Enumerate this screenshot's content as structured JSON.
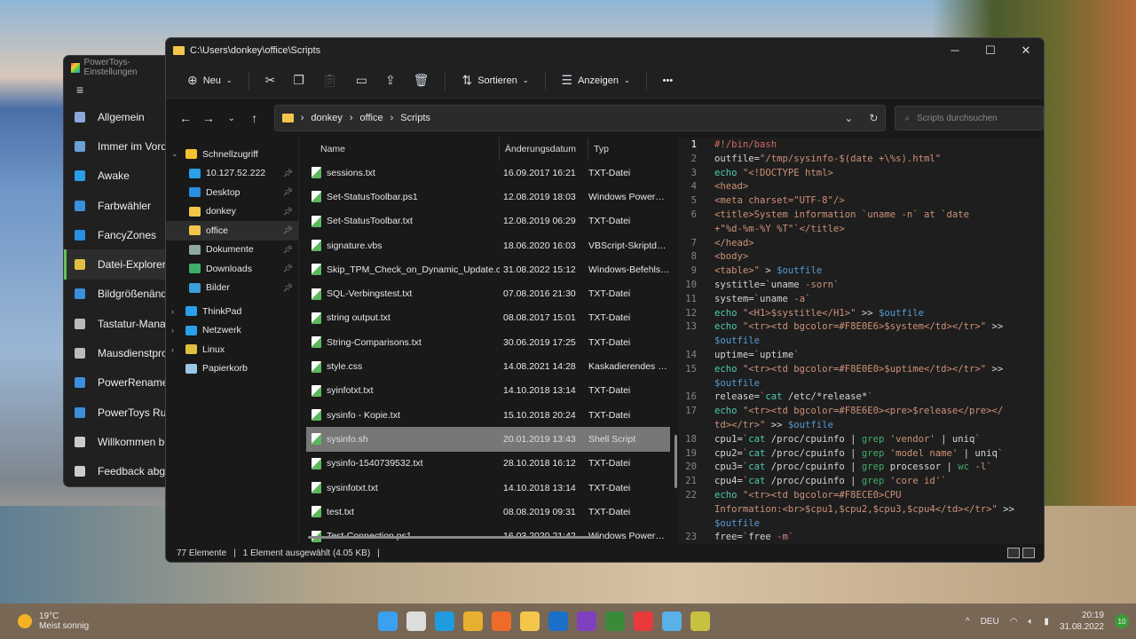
{
  "powertoys": {
    "title": "PowerToys-Einstellungen",
    "menu_icon": "hamburger-icon",
    "items": [
      {
        "label": "Allgemein",
        "color": "#8aa8d8"
      },
      {
        "label": "Immer im Vordergrund",
        "color": "#6ea0d8"
      },
      {
        "label": "Awake",
        "color": "#2a9ee8"
      },
      {
        "label": "Farbwähler",
        "color": "#3b8fdc"
      },
      {
        "label": "FancyZones",
        "color": "#2a8fe0"
      },
      {
        "label": "Datei-Explorer",
        "color": "#e0c040"
      },
      {
        "label": "Bildgrößenänderung",
        "color": "#3b8fdc"
      },
      {
        "label": "Tastatur-Manager",
        "color": "#bbbbbb"
      },
      {
        "label": "Mausdienstprogramme",
        "color": "#bbbbbb"
      },
      {
        "label": "PowerRename",
        "color": "#3b8fdc"
      },
      {
        "label": "PowerToys Run",
        "color": "#3b8fdc"
      },
      {
        "label": "Willkommen bei PowerToys",
        "color": "#cccccc"
      },
      {
        "label": "Feedback abgeben",
        "color": "#cccccc"
      }
    ],
    "selected": "Datei-Explorer"
  },
  "explorer": {
    "title": "C:\\Users\\donkey\\office\\Scripts",
    "toolbar": {
      "new": "Neu",
      "sort": "Sortieren",
      "view": "Anzeigen",
      "more": "•••"
    },
    "breadcrumb": [
      "donkey",
      "office",
      "Scripts"
    ],
    "search_placeholder": "Scripts durchsuchen",
    "nav": [
      {
        "label": "Schnellzugriff",
        "level": 0,
        "chev": "⌄",
        "color": "#f5c230"
      },
      {
        "label": "10.127.52.222",
        "level": 1,
        "pin": true,
        "color": "#2aa0e8"
      },
      {
        "label": "Desktop",
        "level": 1,
        "pin": true,
        "color": "#2a8fe0"
      },
      {
        "label": "donkey",
        "level": 1,
        "pin": true,
        "color": "#f3c64a"
      },
      {
        "label": "office",
        "level": 1,
        "pin": true,
        "color": "#f3c64a",
        "selected": true
      },
      {
        "label": "Dokumente",
        "level": 1,
        "pin": true,
        "color": "#8fa8a0"
      },
      {
        "label": "Downloads",
        "level": 1,
        "pin": true,
        "color": "#3fae6a"
      },
      {
        "label": "Bilder",
        "level": 1,
        "pin": true,
        "color": "#3b9fdc"
      },
      {
        "label": "ThinkPad",
        "level": 0,
        "chev": "›",
        "color": "#2aa0e8"
      },
      {
        "label": "Netzwerk",
        "level": 0,
        "chev": "›",
        "color": "#2aa0e8"
      },
      {
        "label": "Linux",
        "level": 0,
        "chev": "›",
        "color": "#e0c040"
      },
      {
        "label": "Papierkorb",
        "level": 0,
        "color": "#9cc8e8"
      }
    ],
    "columns": {
      "name": "Name",
      "date": "Änderungsdatum",
      "type": "Typ"
    },
    "files": [
      {
        "name": "sessions.txt",
        "date": "16.09.2017 16:21",
        "type": "TXT-Datei"
      },
      {
        "name": "Set-StatusToolbar.ps1",
        "date": "12.08.2019 18:03",
        "type": "Windows PowerSh..."
      },
      {
        "name": "Set-StatusToolbar.txt",
        "date": "12.08.2019 06:29",
        "type": "TXT-Datei"
      },
      {
        "name": "signature.vbs",
        "date": "18.06.2020 16:03",
        "type": "VBScript-Skriptdat..."
      },
      {
        "name": "Skip_TPM_Check_on_Dynamic_Update.cmd",
        "date": "31.08.2022 15:12",
        "type": "Windows-Befehlss..."
      },
      {
        "name": "SQL-Verbingstest.txt",
        "date": "07.08.2016 21:30",
        "type": "TXT-Datei"
      },
      {
        "name": "string output.txt",
        "date": "08.08.2017 15:01",
        "type": "TXT-Datei"
      },
      {
        "name": "String-Comparisons.txt",
        "date": "30.06.2019 17:25",
        "type": "TXT-Datei"
      },
      {
        "name": "style.css",
        "date": "14.08.2021 14:28",
        "type": "Kaskadierendes St..."
      },
      {
        "name": "syinfotxt.txt",
        "date": "14.10.2018 13:14",
        "type": "TXT-Datei"
      },
      {
        "name": "sysinfo - Kopie.txt",
        "date": "15.10.2018 20:24",
        "type": "TXT-Datei"
      },
      {
        "name": "sysinfo.sh",
        "date": "20.01.2019 13:43",
        "type": "Shell Script",
        "selected": true
      },
      {
        "name": "sysinfo-1540739532.txt",
        "date": "28.10.2018 16:12",
        "type": "TXT-Datei"
      },
      {
        "name": "sysinfotxt.txt",
        "date": "14.10.2018 13:14",
        "type": "TXT-Datei"
      },
      {
        "name": "test.txt",
        "date": "08.08.2019 09:31",
        "type": "TXT-Datei"
      },
      {
        "name": "Test-Connection.ps1",
        "date": "16.03.2020 21:42",
        "type": "Windows PowerSh..."
      }
    ],
    "code": [
      {
        "n": "1",
        "segs": [
          [
            "#!/bin/bash",
            "c"
          ]
        ]
      },
      {
        "n": "2",
        "segs": [
          [
            "outfile=",
            "p"
          ],
          [
            "\"/tmp/sysinfo-$(date +\\%s).html\"",
            "s"
          ]
        ]
      },
      {
        "n": "3",
        "segs": [
          [
            "echo ",
            "k"
          ],
          [
            "\"<!DOCTYPE html>",
            "s"
          ]
        ]
      },
      {
        "n": "4",
        "segs": [
          [
            "<head>",
            "s"
          ]
        ]
      },
      {
        "n": "5",
        "segs": [
          [
            "<meta charset=\"UTF-8\"/>",
            "s"
          ]
        ]
      },
      {
        "n": "6",
        "segs": [
          [
            "<title>System information `uname -n` at `date",
            "s"
          ]
        ]
      },
      {
        "n": "",
        "segs": [
          [
            "+\"%d-%m-%Y %T\"`</title>",
            "s"
          ]
        ]
      },
      {
        "n": "7",
        "segs": [
          [
            "</head>",
            "s"
          ]
        ]
      },
      {
        "n": "8",
        "segs": [
          [
            "<body>",
            "s"
          ]
        ]
      },
      {
        "n": "9",
        "segs": [
          [
            "<table>\" ",
            "s"
          ],
          [
            "> ",
            "p"
          ],
          [
            "$outfile",
            "v"
          ]
        ]
      },
      {
        "n": "10",
        "segs": [
          [
            "systitle=",
            "p"
          ],
          [
            "`",
            "s"
          ],
          [
            "uname ",
            "p"
          ],
          [
            "-sorn`",
            "s"
          ]
        ]
      },
      {
        "n": "11",
        "segs": [
          [
            "system=",
            "p"
          ],
          [
            "`",
            "s"
          ],
          [
            "uname ",
            "p"
          ],
          [
            "-a`",
            "s"
          ]
        ]
      },
      {
        "n": "12",
        "segs": [
          [
            "echo ",
            "k"
          ],
          [
            "\"<H1>$systitle</H1>\" ",
            "s"
          ],
          [
            ">> ",
            "p"
          ],
          [
            "$outfile",
            "v"
          ]
        ]
      },
      {
        "n": "13",
        "segs": [
          [
            "echo ",
            "k"
          ],
          [
            "\"<tr><td bgcolor=#F8E0E6>$system</td></tr>\" ",
            "s"
          ],
          [
            ">>",
            "p"
          ]
        ]
      },
      {
        "n": "",
        "segs": [
          [
            "$outfile",
            "v"
          ]
        ]
      },
      {
        "n": "14",
        "segs": [
          [
            "uptime=",
            "p"
          ],
          [
            "`",
            "s"
          ],
          [
            "uptime",
            "p"
          ],
          [
            "`",
            "s"
          ]
        ]
      },
      {
        "n": "15",
        "segs": [
          [
            "echo ",
            "k"
          ],
          [
            "\"<tr><td bgcolor=#F8E0E0>$uptime</td></tr>\" ",
            "s"
          ],
          [
            ">>",
            "p"
          ]
        ]
      },
      {
        "n": "",
        "segs": [
          [
            "$outfile",
            "v"
          ]
        ]
      },
      {
        "n": "16",
        "segs": [
          [
            "release=",
            "p"
          ],
          [
            "`",
            "s"
          ],
          [
            "cat ",
            "k"
          ],
          [
            "/etc/*release*",
            "p"
          ],
          [
            "`",
            "s"
          ]
        ]
      },
      {
        "n": "17",
        "segs": [
          [
            "echo ",
            "k"
          ],
          [
            "\"<tr><td bgcolor=#F8E6E0><pre>$release</pre></",
            "s"
          ]
        ]
      },
      {
        "n": "",
        "segs": [
          [
            "td></tr>\" ",
            "s"
          ],
          [
            ">> ",
            "p"
          ],
          [
            "$outfile",
            "v"
          ]
        ]
      },
      {
        "n": "18",
        "segs": [
          [
            "cpu1=",
            "p"
          ],
          [
            "`",
            "s"
          ],
          [
            "cat ",
            "k"
          ],
          [
            "/proc/cpuinfo | ",
            "p"
          ],
          [
            "grep ",
            "g"
          ],
          [
            "'vendor' ",
            "s"
          ],
          [
            "| uniq",
            "p"
          ],
          [
            "`",
            "s"
          ]
        ]
      },
      {
        "n": "19",
        "segs": [
          [
            "cpu2=",
            "p"
          ],
          [
            "`",
            "s"
          ],
          [
            "cat ",
            "k"
          ],
          [
            "/proc/cpuinfo | ",
            "p"
          ],
          [
            "grep ",
            "g"
          ],
          [
            "'model name' ",
            "s"
          ],
          [
            "| uniq",
            "p"
          ],
          [
            "`",
            "s"
          ]
        ]
      },
      {
        "n": "20",
        "segs": [
          [
            "cpu3=",
            "p"
          ],
          [
            "`",
            "s"
          ],
          [
            "cat ",
            "k"
          ],
          [
            "/proc/cpuinfo | ",
            "p"
          ],
          [
            "grep ",
            "g"
          ],
          [
            "processor | ",
            "p"
          ],
          [
            "wc ",
            "g"
          ],
          [
            "-l`",
            "s"
          ]
        ]
      },
      {
        "n": "21",
        "segs": [
          [
            "cpu4=",
            "p"
          ],
          [
            "`",
            "s"
          ],
          [
            "cat ",
            "k"
          ],
          [
            "/proc/cpuinfo | ",
            "p"
          ],
          [
            "grep ",
            "g"
          ],
          [
            "'core id'`",
            "s"
          ]
        ]
      },
      {
        "n": "22",
        "segs": [
          [
            "echo ",
            "k"
          ],
          [
            "\"<tr><td bgcolor=#F8ECE0>CPU",
            "s"
          ]
        ]
      },
      {
        "n": "",
        "segs": [
          [
            "Information:<br>$cpu1,$cpu2,$cpu3,$cpu4</td></tr>\" ",
            "s"
          ],
          [
            ">>",
            "p"
          ]
        ]
      },
      {
        "n": "",
        "segs": [
          [
            "$outfile",
            "v"
          ]
        ]
      },
      {
        "n": "23",
        "segs": [
          [
            "free=",
            "p"
          ],
          [
            "`",
            "s"
          ],
          [
            "free ",
            "p"
          ],
          [
            "-m`",
            "s"
          ]
        ]
      }
    ],
    "status": {
      "count": "77 Elemente",
      "selection": "1 Element ausgewählt (4.05 KB)"
    }
  },
  "taskbar": {
    "temp": "19°C",
    "weather": "Meist sonnig",
    "lang": "DEU",
    "time": "20:19",
    "date": "31.08.2022",
    "badge": "10",
    "apps": [
      {
        "name": "start",
        "color": "#3aa0f0"
      },
      {
        "name": "task-view",
        "color": "#dddddd"
      },
      {
        "name": "edge",
        "color": "#1f9be0"
      },
      {
        "name": "chrome",
        "color": "#e8b030"
      },
      {
        "name": "firefox",
        "color": "#f06a2a"
      },
      {
        "name": "file-explorer",
        "color": "#f3c64a"
      },
      {
        "name": "outlook",
        "color": "#1a6fc8"
      },
      {
        "name": "onenote",
        "color": "#8040c0"
      },
      {
        "name": "vim",
        "color": "#3a8a3a"
      },
      {
        "name": "anydesk",
        "color": "#e83a3a"
      },
      {
        "name": "notepad",
        "color": "#5ab0e8"
      },
      {
        "name": "powertoys",
        "color": "#c8c040"
      }
    ]
  }
}
